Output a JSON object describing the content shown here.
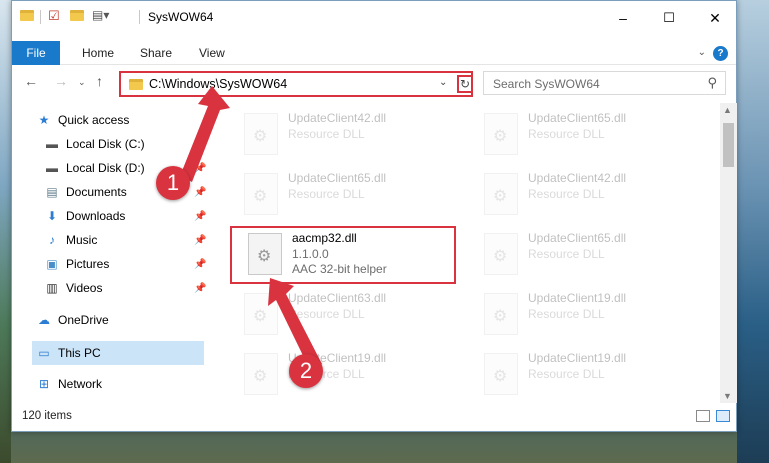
{
  "window": {
    "title": "SysWOW64",
    "minimize_icon": "–",
    "maximize_icon": "☐",
    "close_icon": "✕"
  },
  "ribbon": {
    "tabs": [
      {
        "label": "File"
      },
      {
        "label": "Home"
      },
      {
        "label": "Share"
      },
      {
        "label": "View"
      }
    ],
    "help": "?"
  },
  "address_bar": {
    "path": "C:\\Windows\\SysWOW64"
  },
  "search": {
    "placeholder": "Search SysWOW64"
  },
  "navigation": {
    "items": [
      {
        "label": "Quick access",
        "icon": "star-icon",
        "glyph": "★"
      },
      {
        "label": "Local Disk (C:)",
        "icon": "drive-icon",
        "glyph": "▬"
      },
      {
        "label": "Local Disk (D:)",
        "icon": "drive-icon",
        "glyph": "▬"
      },
      {
        "label": "Documents",
        "icon": "documents-icon",
        "glyph": "▤"
      },
      {
        "label": "Downloads",
        "icon": "download-icon",
        "glyph": "⬇"
      },
      {
        "label": "Music",
        "icon": "music-icon",
        "glyph": "♪"
      },
      {
        "label": "Pictures",
        "icon": "pictures-icon",
        "glyph": "▣"
      },
      {
        "label": "Videos",
        "icon": "videos-icon",
        "glyph": "▥"
      },
      {
        "label": "OneDrive",
        "icon": "cloud-icon",
        "glyph": "☁"
      },
      {
        "label": "This PC",
        "icon": "computer-icon",
        "glyph": "▭"
      },
      {
        "label": "Network",
        "icon": "network-icon",
        "glyph": "⊞"
      }
    ]
  },
  "files": [
    {
      "name": "UpdateClient42.dll",
      "type": "Resource DLL"
    },
    {
      "name": "UpdateClient65.dll",
      "type": "Resource DLL"
    },
    {
      "name": "UpdateClient65.dll",
      "type": "Resource DLL"
    },
    {
      "name": "UpdateClient42.dll",
      "type": "Resource DLL"
    },
    {
      "name": "aacmp32.dll",
      "version": "1.1.0.0",
      "type": "AAC 32-bit helper"
    },
    {
      "name": "UpdateClient65.dll",
      "type": "Resource DLL"
    },
    {
      "name": "UpdateClient63.dll",
      "type": "Resource DLL"
    },
    {
      "name": "UpdateClient19.dll",
      "type": "Resource DLL"
    },
    {
      "name": "UpdateClient19.dll",
      "type": "Resource DLL"
    },
    {
      "name": "UpdateClient19.dll",
      "type": "Resource DLL"
    }
  ],
  "status_bar": {
    "item_count": "120 items"
  },
  "annotations": {
    "step1": "1",
    "step2": "2"
  }
}
